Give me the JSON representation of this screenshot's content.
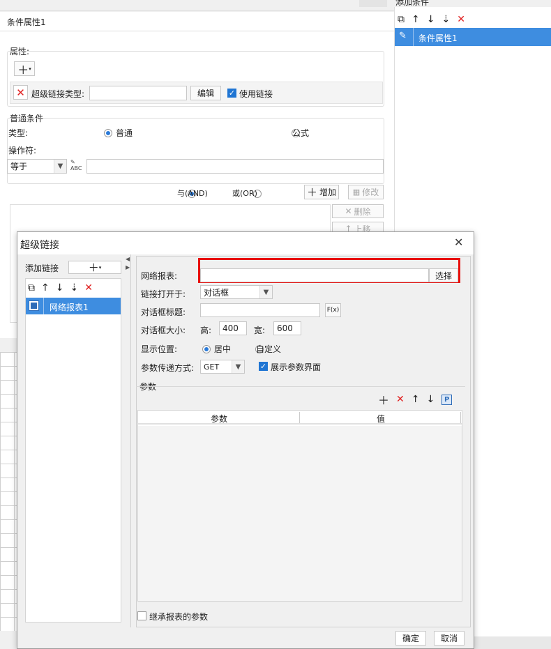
{
  "background": {
    "title": "条件属性1",
    "right_tab": "添加条件",
    "properties_label": "属性:",
    "hyperlink_type_label": "超级链接类型:",
    "edit_button": "编辑",
    "use_link_label": "使用链接",
    "common_condition_label": "普通条件",
    "type_label": "类型:",
    "type_normal": "普通",
    "type_formula": "公式",
    "operator_label": "操作符:",
    "operator_value": "等于",
    "and_label": "与(AND)",
    "or_label": "或(OR)",
    "add_button": "增加",
    "modify_button": "修改",
    "delete_button": "删除",
    "up_button": "上移",
    "condition_item": "条件属性1"
  },
  "dialog": {
    "title": "超级链接",
    "add_link_label": "添加链接",
    "list_item": "网络报表1",
    "web_report_label": "网络报表:",
    "web_report_value": "",
    "select_button": "选择",
    "open_in_label": "链接打开于:",
    "open_in_value": "对话框",
    "dialog_title_label": "对话框标题:",
    "dialog_title_value": "",
    "formula_button": "F(x)",
    "dialog_size_label": "对话框大小:",
    "height_label": "高:",
    "height_value": "400",
    "width_label": "宽:",
    "width_value": "600",
    "position_label": "显示位置:",
    "position_center": "居中",
    "position_custom": "自定义",
    "param_method_label": "参数传递方式:",
    "param_method_value": "GET",
    "show_param_label": "展示参数界面",
    "params_label": "参数",
    "table_headers": [
      "参数",
      "值"
    ],
    "inherit_label": "继承报表的参数",
    "ok_button": "确定",
    "cancel_button": "取消"
  },
  "colors": {
    "highlight_red": "#e8100d",
    "selection_blue": "#3e8de0",
    "delete_red": "#e01e1e"
  }
}
